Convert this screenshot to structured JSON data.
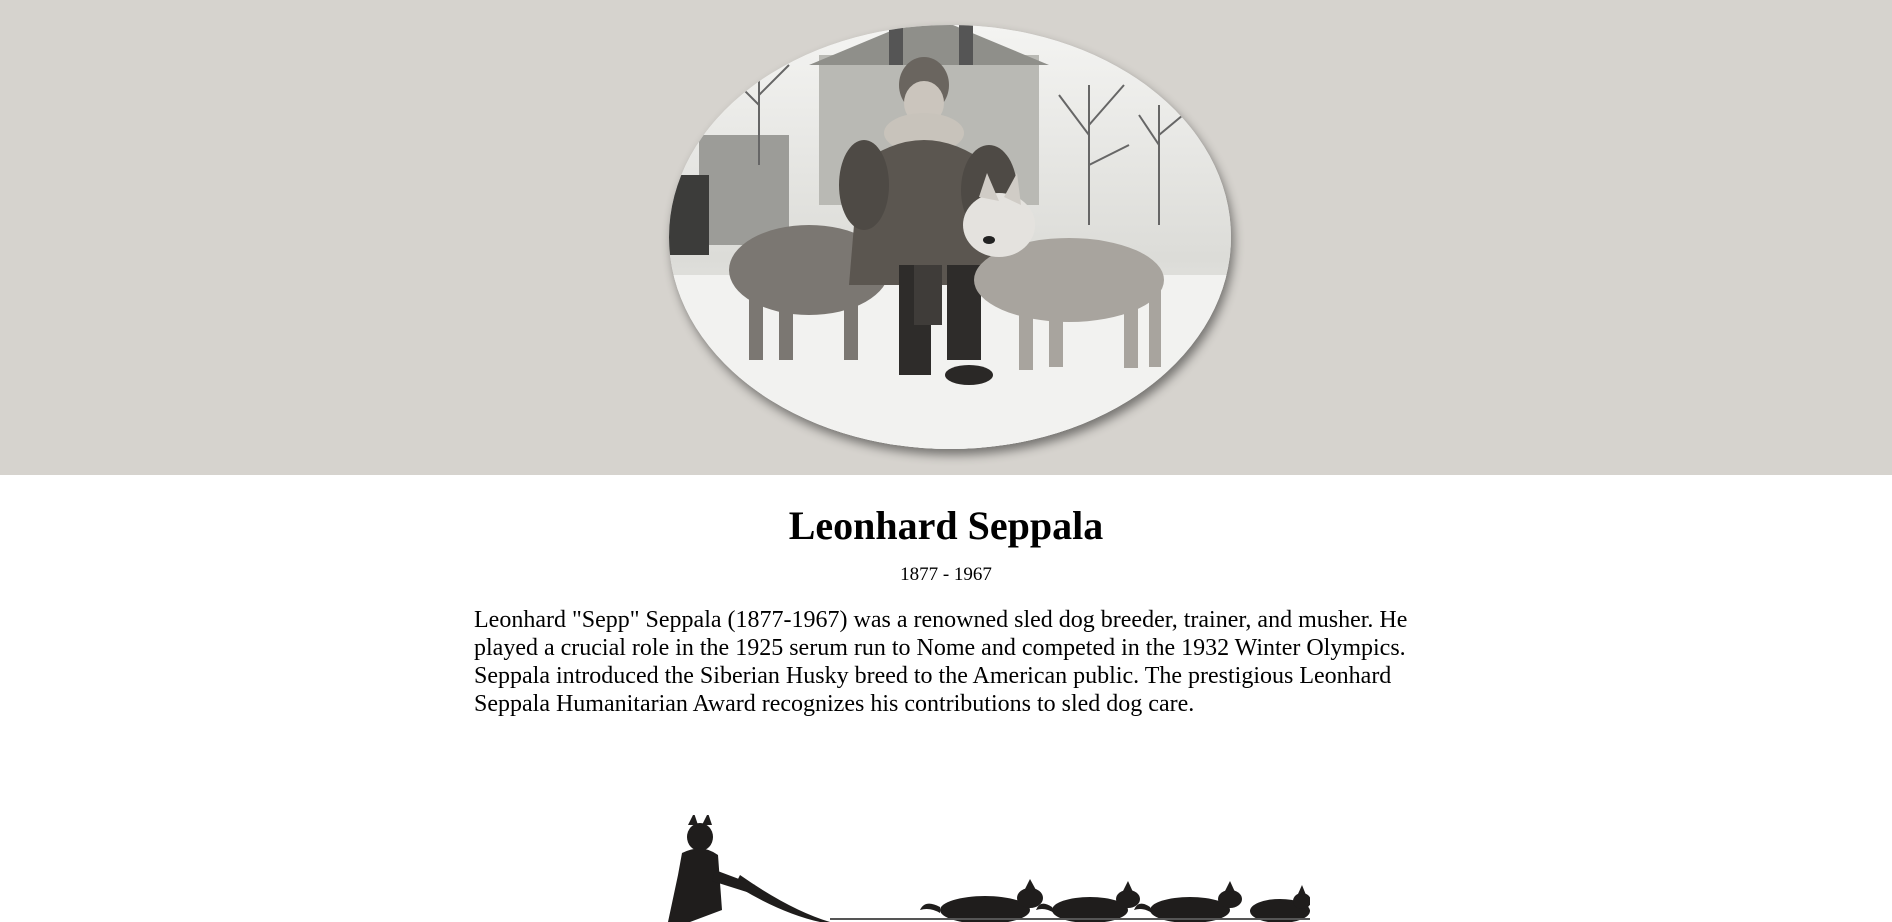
{
  "hero": {
    "portrait_alt": "Leonhard Seppala with two sled dogs"
  },
  "profile": {
    "name": "Leonhard Seppala",
    "dates": "1877 - 1967",
    "bio": "Leonhard \"Sepp\" Seppala (1877-1967) was a renowned sled dog breeder, trainer, and musher. He played a crucial role in the 1925 serum run to Nome and competed in the 1932 Winter Olympics. Seppala introduced the Siberian Husky breed to the American public. The prestigious Leonhard Seppala Humanitarian Award recognizes his contributions to sled dog care."
  },
  "colors": {
    "hero_background": "#d6d3ce",
    "page_background": "#ffffff",
    "text": "#000000"
  }
}
